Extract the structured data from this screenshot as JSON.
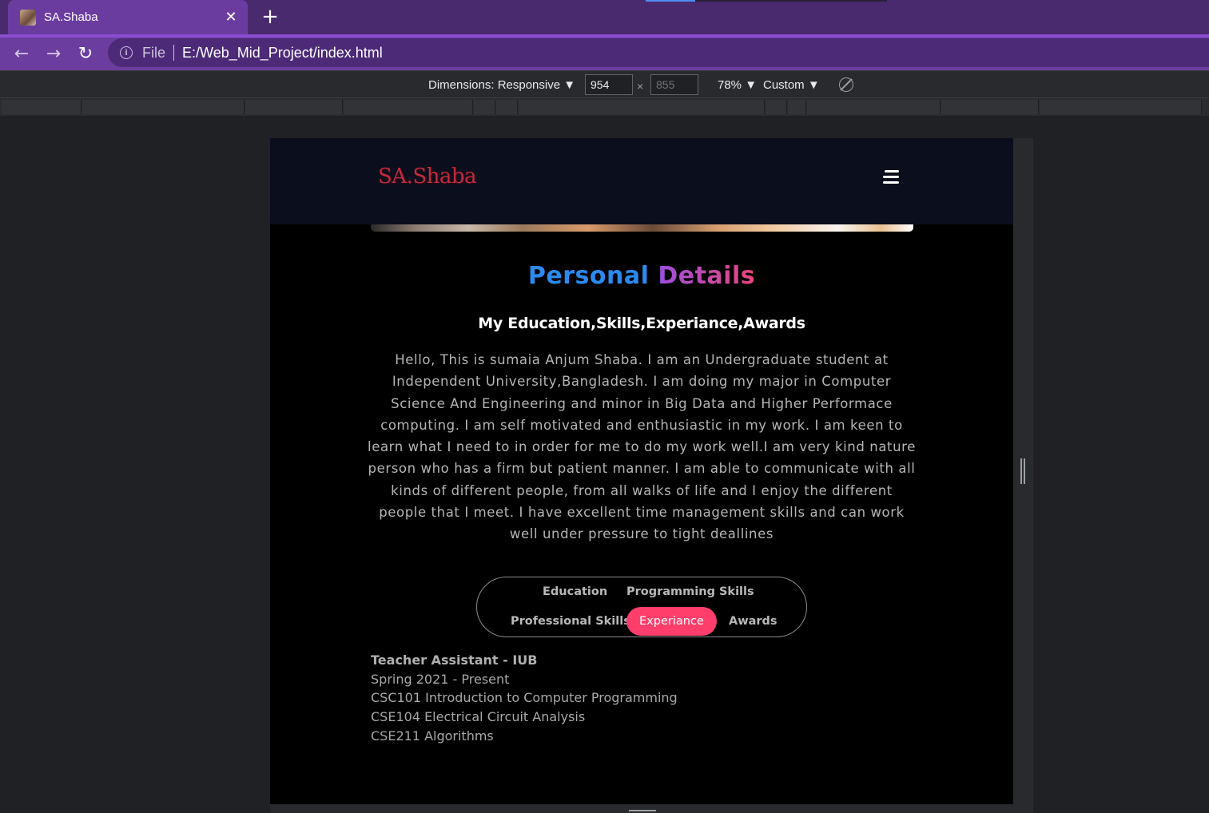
{
  "browser": {
    "tab_title": "SA.Shaba",
    "tab_close": "✕",
    "new_tab": "+",
    "back": "←",
    "forward": "→",
    "reload": "↻",
    "scheme": "File",
    "url": "E:/Web_Mid_Project/index.html"
  },
  "devtools": {
    "dimensions_label": "Dimensions: Responsive ▼",
    "width_value": "954",
    "times": "×",
    "height_value": "855",
    "zoom": "78% ▼",
    "throttle": "Custom ▼"
  },
  "site": {
    "logo": "SA.Shaba",
    "title_part1": "Personal",
    "title_part2": "Details",
    "subtitle": "My Education,Skills,Experiance,Awards",
    "bio": "Hello, This is sumaia Anjum Shaba. I am an Undergraduate student at Independent University,Bangladesh. I am doing my major in Computer Science And Engineering and minor in Big Data and Higher Performace computing. I am self motivated and enthusiastic in my work. I am keen to learn what I need to in order for me to do my work well.I am very kind nature person who has a firm but patient manner. I am able to communicate with all kinds of different people, from all walks of life and I enjoy the different people that I meet. I have excellent time management skills and can work well under pressure to tight deallines",
    "tabs": {
      "education": "Education",
      "programming": "Programming Skills",
      "professional": "Professional Skills",
      "experiance": "Experiance",
      "awards": "Awards"
    },
    "experience": {
      "title": "Teacher Assistant - IUB",
      "period": "Spring 2021 - Present",
      "courses": [
        "CSC101 Introduction to Computer Programming",
        "CSE104 Electrical Circuit Analysis",
        "CSE211 Algorithms"
      ]
    }
  },
  "colors": {
    "accent_tab": "#ff3e6c",
    "logo": "#c22a3f",
    "title_blue": "#2b8af0",
    "browser_purple": "#6a3d9e"
  }
}
